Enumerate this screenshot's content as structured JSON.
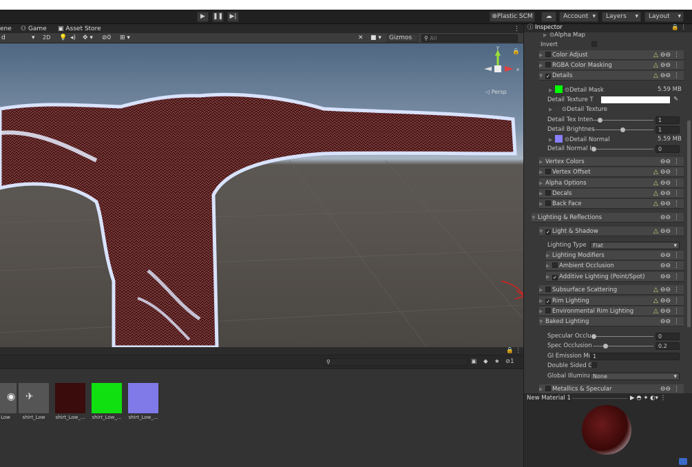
{
  "toolbar": {
    "plastic": "⊕Plastic SCM",
    "account": "Account",
    "layers": "Layers",
    "layout": "Layout"
  },
  "scene_tabs": [
    "ene",
    "Game",
    "Asset Store"
  ],
  "scene_toolbar": {
    "mode": "d",
    "two_d": "2D",
    "hidden_count": "0",
    "gizmos": "Gizmos",
    "search_placeholder": "All",
    "persp": "◁ Persp"
  },
  "project": {
    "hidden_count": "1",
    "assets": [
      {
        "label": "Low"
      },
      {
        "label": "shirt_Low"
      },
      {
        "label": "shirt_Low_..."
      },
      {
        "label": "shirt_Low_..."
      },
      {
        "label": "shirt_Low_..."
      }
    ]
  },
  "inspector": {
    "title": "Inspector",
    "alpha_map": "⊙Alpha Map",
    "invert": "Invert",
    "sections_top": [
      {
        "label": "Color Adjust"
      },
      {
        "label": "RGBA Color Masking"
      },
      {
        "label": "Details"
      }
    ],
    "detail_mask": "⊙Detail Mask",
    "detail_mask_size": "5.59 MB",
    "detail_texture_t": "Detail Texture T",
    "detail_texture": "⊙Detail Texture",
    "detail_tex_inten": "Detail Tex Inten",
    "detail_tex_inten_val": "1",
    "detail_brightnes": "Detail Brightnes",
    "detail_brightnes_val": "1",
    "detail_normal": "⊙Detail Normal",
    "detail_normal_size": "5.59 MB",
    "detail_normal_in": "Detail Normal In",
    "detail_normal_in_val": "0",
    "sections_mid": [
      {
        "label": "Vertex Colors"
      },
      {
        "label": "Vertex Offset"
      },
      {
        "label": "Alpha Options"
      },
      {
        "label": "Decals"
      },
      {
        "label": "Back Face"
      }
    ],
    "lighting_reflections": "Lighting & Reflections",
    "light_shadow": "Light & Shadow",
    "lighting_type": "Lighting Type",
    "lighting_type_val": "Flat",
    "lighting_modifiers": "Lighting Modifiers",
    "ambient_occlusion": "Ambient Occlusion",
    "additive_lighting": "Additive Lighting (Point/Spot)",
    "subsurface": "Subsurface Scattering",
    "rim_lighting": "Rim Lighting",
    "env_rim": "Environmental Rim Lighting",
    "baked_lighting": "Baked Lighting",
    "specular_occlu": "Specular Occlu",
    "specular_occlu_val": "0",
    "spec_occlusion": "Spec Occlusion",
    "spec_occlusion_val": "0.2",
    "gi_emission": "GI Emission Mul",
    "gi_emission_val": "1",
    "double_sided": "Double Sided GI",
    "global_illum": "Global Illuminati",
    "global_illum_val": "None",
    "metallics": "Metallics & Specular",
    "preview_title": "New Material 1"
  },
  "colors": {
    "annotation": "#d62020",
    "shirt": "#4a1010",
    "detail_mask_swatch": "#00ff00",
    "detail_normal_swatch": "#8a80ff"
  }
}
